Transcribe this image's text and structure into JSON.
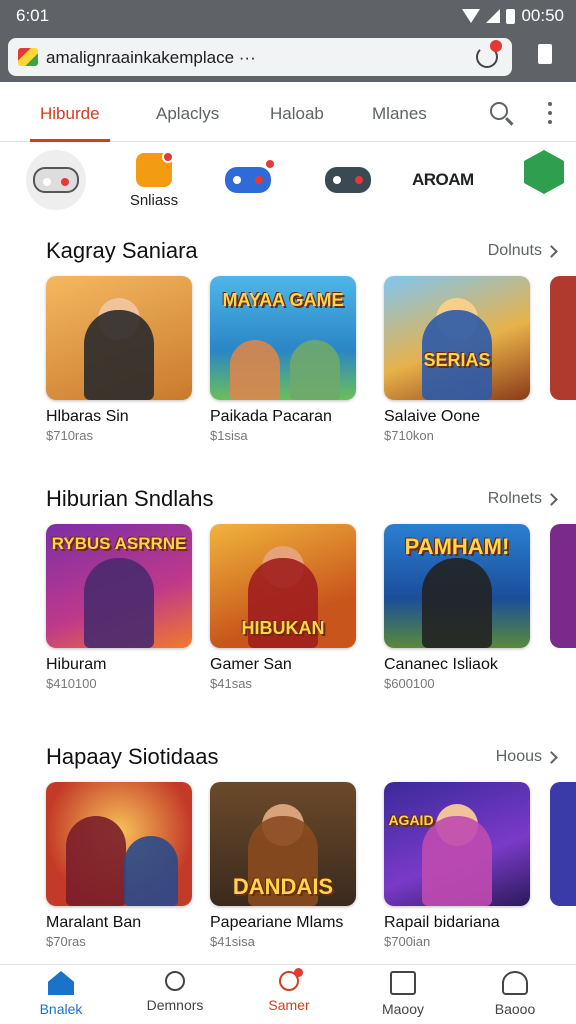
{
  "status_bar": {
    "time": "6:01",
    "clock_right": "00:50"
  },
  "url_bar": {
    "url": "amalignraainkakemplace ···"
  },
  "tabs": [
    {
      "label": "Hiburde",
      "active": true
    },
    {
      "label": "Aplaclys",
      "active": false
    },
    {
      "label": "Haloab",
      "active": false
    },
    {
      "label": "Mlanes",
      "active": false
    }
  ],
  "categories": [
    {
      "icon": "gamepad-icon",
      "label": ""
    },
    {
      "icon": "smiley-icon",
      "label": "Snliass"
    },
    {
      "icon": "controller-blue-icon",
      "label": ""
    },
    {
      "icon": "controller-dark-icon",
      "label": ""
    },
    {
      "icon": "aroam-logo",
      "label": "AROAM"
    },
    {
      "icon": "green-s-icon",
      "label": ""
    }
  ],
  "sections": [
    {
      "title": "Kagray Saniara",
      "more": "Dolnuts",
      "cards": [
        {
          "name": "Hlbaras Sin",
          "sub": "$710ras",
          "art_text": ""
        },
        {
          "name": "Paikada Pacaran",
          "sub": "$1sisa",
          "art_text": "MAYAA GAME"
        },
        {
          "name": "Salaive Oone",
          "sub": "$710kon",
          "art_text": "SERIAS"
        }
      ]
    },
    {
      "title": "Hiburian Sndlahs",
      "more": "Rolnets",
      "cards": [
        {
          "name": "Hiburam",
          "sub": "$410100",
          "art_text": "RYBUS ASRRNE"
        },
        {
          "name": "Gamer San",
          "sub": "$41sas",
          "art_text": "HIBUKAN"
        },
        {
          "name": "Cananec Isliaok",
          "sub": "$600100",
          "art_text": "PAMHAM!"
        }
      ]
    },
    {
      "title": "Hapaay Siotidaas",
      "more": "Hoous",
      "cards": [
        {
          "name": "Maralant Ban",
          "sub": "$70ras",
          "art_text": ""
        },
        {
          "name": "Papeariane Mlams",
          "sub": "$41sisa",
          "art_text": "DANDAIS"
        },
        {
          "name": "Rapail bidariana",
          "sub": "$700ian",
          "art_text": "AGAID"
        }
      ]
    }
  ],
  "bottom_nav": [
    {
      "label": "Bnalek",
      "state": "active"
    },
    {
      "label": "Demnors",
      "state": "normal"
    },
    {
      "label": "Samer",
      "state": "highlight"
    },
    {
      "label": "Maooy",
      "state": "normal"
    },
    {
      "label": "Baooo",
      "state": "normal"
    }
  ],
  "colors": {
    "accent": "#d23f1f",
    "nav_active": "#1a73c8",
    "status_bar": "#5f6368"
  }
}
